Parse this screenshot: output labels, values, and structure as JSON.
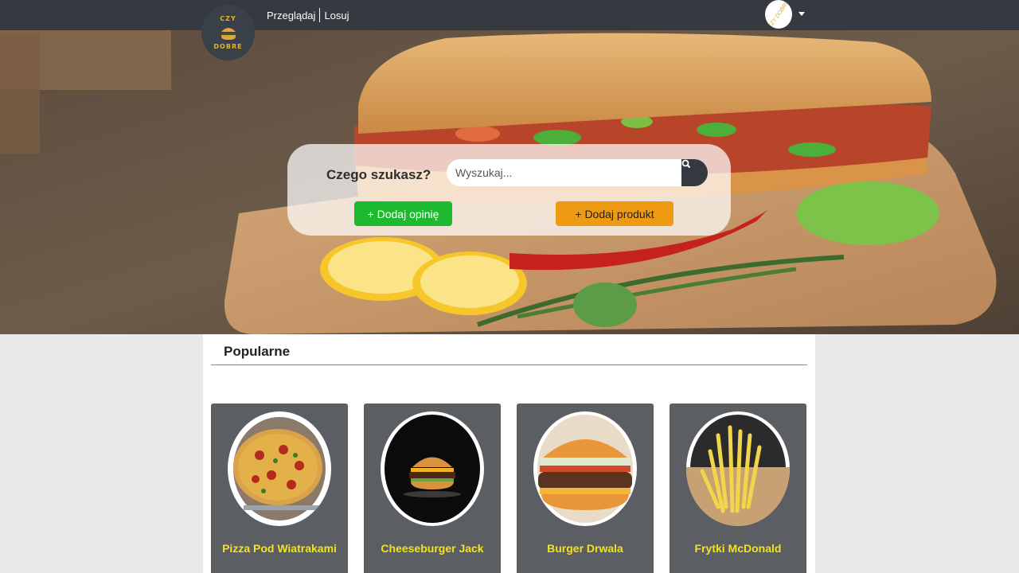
{
  "nav": {
    "logo_top": "CZY",
    "logo_bottom": "DOBRE",
    "links": [
      "Przeglądaj",
      "Losuj"
    ],
    "avatar_text": "CZY DOBRE"
  },
  "hero": {
    "search_label": "Czego szukasz?",
    "search_placeholder": "Wyszukaj...",
    "add_opinion": "+ Dodaj opinię",
    "add_product": "+ Dodaj produkt"
  },
  "popular": {
    "title": "Popularne",
    "items": [
      {
        "name": "Pizza Pod Wiatrakami",
        "image": "pizza"
      },
      {
        "name": "Cheeseburger Jack",
        "image": "cheeseburger"
      },
      {
        "name": "Burger Drwala",
        "image": "burger"
      },
      {
        "name": "Frytki McDonald",
        "image": "fries"
      }
    ]
  },
  "colors": {
    "navbar": "#343a40",
    "opinion_button": "#1db92e",
    "product_button": "#ee9a12",
    "card_bg": "#5b5e63",
    "card_title": "#f3e21c"
  }
}
